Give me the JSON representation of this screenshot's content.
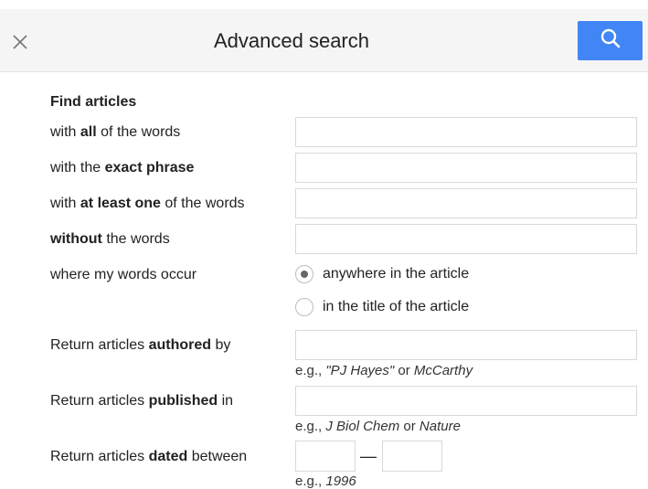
{
  "header": {
    "title": "Advanced search",
    "close_icon": "close-icon",
    "search_icon": "search-icon",
    "accent_color": "#4285f4"
  },
  "form": {
    "section_title": "Find articles",
    "all_words": {
      "pre": "with ",
      "bold": "all",
      "post": " of the words",
      "value": ""
    },
    "exact_phrase": {
      "pre": "with the ",
      "bold": "exact phrase",
      "post": "",
      "value": ""
    },
    "at_least_one": {
      "pre": "with ",
      "bold": "at least one",
      "post": " of the words",
      "value": ""
    },
    "without": {
      "pre": "",
      "bold": "without",
      "post": " the words",
      "value": ""
    },
    "occur": {
      "label": "where my words occur",
      "options": [
        "anywhere in the article",
        "in the title of the article"
      ],
      "selected": "anywhere in the article"
    },
    "authored": {
      "pre": "Return articles ",
      "bold": "authored",
      "post": " by",
      "value": "",
      "hint_pre": "e.g., ",
      "hint_i1": "\"PJ Hayes\"",
      "hint_mid": " or ",
      "hint_i2": "McCarthy"
    },
    "published": {
      "pre": "Return articles ",
      "bold": "published",
      "post": " in",
      "value": "",
      "hint_pre": "e.g., ",
      "hint_i1": "J Biol Chem",
      "hint_mid": " or ",
      "hint_i2": "Nature"
    },
    "dated": {
      "pre": "Return articles ",
      "bold": "dated",
      "post": " between",
      "from": "",
      "to": "",
      "separator": "—",
      "hint_pre": "e.g., ",
      "hint_i1": "1996"
    }
  }
}
